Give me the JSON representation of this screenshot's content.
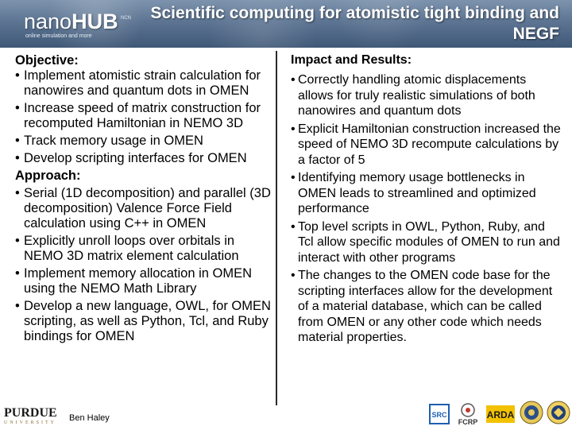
{
  "header": {
    "logo_text_bold": "nano",
    "logo_text_rest": "HUB",
    "logo_tagline": "online simulation and more",
    "ncn_mark": "NCN",
    "title": "Scientific computing for atomistic tight binding and NEGF"
  },
  "left": {
    "objective_heading": "Objective:",
    "objective_items": [
      "Implement atomistic strain calculation for nanowires and quantum dots in OMEN",
      "Increase speed of matrix construction for recomputed Hamiltonian in NEMO 3D",
      "Track memory usage in OMEN",
      "Develop scripting interfaces for OMEN"
    ],
    "approach_heading": "Approach:",
    "approach_items": [
      "Serial (1D decomposition) and parallel (3D decomposition) Valence Force Field calculation using C++ in OMEN",
      "Explicitly unroll loops over orbitals in NEMO 3D matrix element calculation",
      "Implement memory allocation in OMEN using the NEMO Math Library",
      "Develop a new language, OWL, for OMEN scripting, as well as Python, Tcl, and Ruby bindings for OMEN"
    ]
  },
  "right": {
    "heading": "Impact and Results:",
    "items": [
      "Correctly handling atomic displacements allows for truly realistic simulations of both nanowires and quantum dots",
      "Explicit Hamiltonian construction increased the speed of NEMO 3D recompute calculations by a factor of 5",
      "Identifying memory usage bottlenecks in OMEN leads to streamlined and optimized  performance",
      "Top level scripts in OWL, Python, Ruby, and Tcl allow specific modules of OMEN to run and interact with other programs",
      "The changes to the OMEN code base for the scripting interfaces allow for the development of a material database, which can be called from OMEN or any other code which needs material properties."
    ]
  },
  "footer": {
    "university": "PURDUE",
    "university_sub": "UNIVERSITY",
    "author": "Ben Haley",
    "logos": [
      "SRC",
      "FCRP",
      "ARDA",
      "seal-1",
      "seal-2"
    ]
  }
}
